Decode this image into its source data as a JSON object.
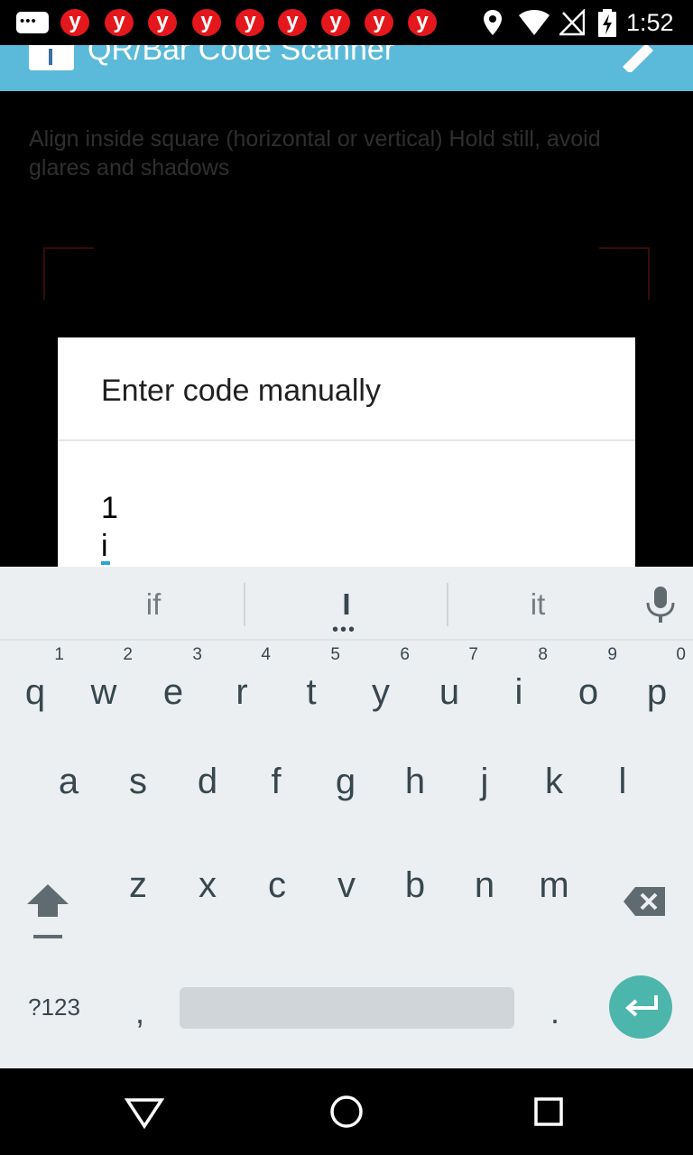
{
  "status_bar": {
    "notification_letter": "y",
    "notification_count": 9,
    "time": "1:52",
    "icons": [
      "chat-icon",
      "location-icon",
      "wifi-icon",
      "no-signal-icon",
      "battery-charging-icon"
    ]
  },
  "app_bar": {
    "title": "QR/Bar Code Scanner",
    "color": "#5bbad9"
  },
  "scanner": {
    "hint": "Align inside square (horizontal or vertical) Hold still, avoid glares and shadows"
  },
  "dialog": {
    "title": "Enter code manually",
    "input_value": "1\ni"
  },
  "keyboard": {
    "suggestions": [
      "if",
      "I",
      "it"
    ],
    "row1": [
      {
        "key": "q",
        "hint": "1"
      },
      {
        "key": "w",
        "hint": "2"
      },
      {
        "key": "e",
        "hint": "3"
      },
      {
        "key": "r",
        "hint": "4"
      },
      {
        "key": "t",
        "hint": "5"
      },
      {
        "key": "y",
        "hint": "6"
      },
      {
        "key": "u",
        "hint": "7"
      },
      {
        "key": "i",
        "hint": "8"
      },
      {
        "key": "o",
        "hint": "9"
      },
      {
        "key": "p",
        "hint": "0"
      }
    ],
    "row2": [
      "a",
      "s",
      "d",
      "f",
      "g",
      "h",
      "j",
      "k",
      "l"
    ],
    "row3": [
      "z",
      "x",
      "c",
      "v",
      "b",
      "n",
      "m"
    ],
    "symbols_label": "?123",
    "comma": ",",
    "period": ".",
    "enter_color": "#4db6ac"
  },
  "nav_bar": {
    "icons": [
      "back-icon",
      "home-icon",
      "recents-icon"
    ]
  }
}
